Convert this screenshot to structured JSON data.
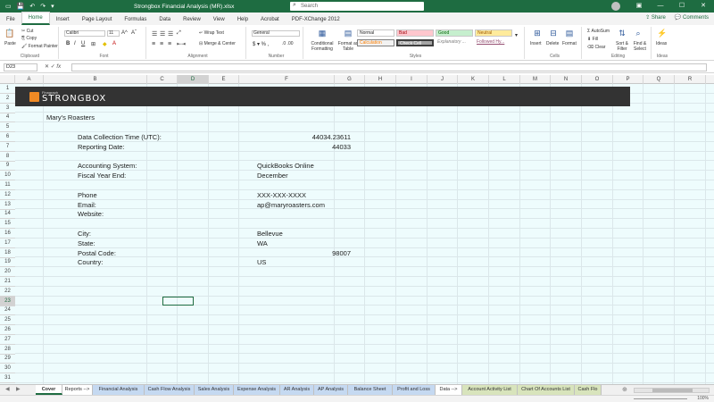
{
  "window": {
    "title": "Strongbox Financial Analysis (MR).xlsx",
    "search_placeholder": "Search",
    "minimize": "—",
    "maximize": "☐",
    "close": "✕"
  },
  "menu": {
    "tabs": [
      "File",
      "Home",
      "Insert",
      "Page Layout",
      "Formulas",
      "Data",
      "Review",
      "View",
      "Help",
      "Acrobat",
      "PDF-XChange 2012"
    ],
    "active": "Home",
    "share": "Share",
    "comments": "Comments"
  },
  "ribbon": {
    "clipboard": {
      "label": "Clipboard",
      "paste": "Paste",
      "cut": "Cut",
      "copy": "Copy",
      "format_painter": "Format Painter"
    },
    "font": {
      "label": "Font",
      "font_name": "Calibri",
      "font_size": "11"
    },
    "alignment": {
      "label": "Alignment",
      "wrap_text": "Wrap Text",
      "merge_center": "Merge & Center"
    },
    "number": {
      "label": "Number",
      "format": "General"
    },
    "styles": {
      "label": "Styles",
      "conditional": "Conditional Formatting",
      "format_table": "Format as Table",
      "normal": "Normal",
      "bad": "Bad",
      "good": "Good",
      "neutral": "Neutral",
      "calculation": "Calculation",
      "check_cell": "Check Cell",
      "explanatory": "Explanatory ...",
      "followed": "Followed Hy..."
    },
    "cells": {
      "label": "Cells",
      "insert": "Insert",
      "delete": "Delete",
      "format": "Format"
    },
    "editing": {
      "label": "Editing",
      "autosum": "AutoSum",
      "fill": "Fill",
      "clear": "Clear",
      "sort_filter": "Sort & Filter",
      "find_select": "Find & Select"
    },
    "ideas": {
      "label": "Ideas",
      "ideas": "Ideas"
    }
  },
  "formula_bar": {
    "name_box": "D23",
    "content": ""
  },
  "columns": [
    "A",
    "B",
    "C",
    "D",
    "E",
    "F",
    "G",
    "H",
    "I",
    "J",
    "K",
    "L",
    "M",
    "N",
    "O",
    "P",
    "Q",
    "R"
  ],
  "selected_column": "D",
  "selected_row": "23",
  "rows": [
    "1",
    "2",
    "3",
    "4",
    "5",
    "6",
    "7",
    "8",
    "9",
    "10",
    "11",
    "12",
    "13",
    "14",
    "15",
    "16",
    "17",
    "18",
    "19",
    "20",
    "21",
    "22",
    "23",
    "24",
    "25",
    "26",
    "27",
    "28",
    "29",
    "30",
    "31"
  ],
  "banner": {
    "small_text": "Finagraph",
    "logo_text": "STRONGBOX"
  },
  "company": "Mary's Roasters",
  "fields": [
    {
      "label": "Data Collection Time (UTC):",
      "value": "44034.23611",
      "numeric": true,
      "row": 6
    },
    {
      "label": "Reporting Date:",
      "value": "44033",
      "numeric": true,
      "row": 7
    },
    {
      "label": "Accounting System:",
      "value": "QuickBooks Online",
      "numeric": false,
      "row": 9
    },
    {
      "label": "Fiscal Year End:",
      "value": "December",
      "numeric": false,
      "row": 10
    },
    {
      "label": "Phone",
      "value": "XXX-XXX-XXXX",
      "numeric": false,
      "row": 12
    },
    {
      "label": "Email:",
      "value": "ap@maryroasters.com",
      "numeric": false,
      "row": 13
    },
    {
      "label": "Website:",
      "value": "",
      "numeric": false,
      "row": 14
    },
    {
      "label": "City:",
      "value": "Bellevue",
      "numeric": false,
      "row": 16
    },
    {
      "label": "State:",
      "value": "WA",
      "numeric": false,
      "row": 17
    },
    {
      "label": "Postal Code:",
      "value": "98007",
      "numeric": true,
      "row": 18
    },
    {
      "label": "Country:",
      "value": "US",
      "numeric": false,
      "row": 19
    }
  ],
  "sheet_tabs": [
    {
      "name": "Cover",
      "color": "#ffffff"
    },
    {
      "name": "Reports -->",
      "color": "#ffffff"
    },
    {
      "name": "Financial Analysis",
      "color": "#c5d9f1"
    },
    {
      "name": "Cash Flow Analysis",
      "color": "#c5d9f1"
    },
    {
      "name": "Sales Analysis",
      "color": "#c5d9f1"
    },
    {
      "name": "Expense Analysis",
      "color": "#c5d9f1"
    },
    {
      "name": "AR Analysis",
      "color": "#c5d9f1"
    },
    {
      "name": "AP Analysis",
      "color": "#c5d9f1"
    },
    {
      "name": "Balance Sheet",
      "color": "#c5d9f1"
    },
    {
      "name": "Profit and Loss",
      "color": "#c5d9f1"
    },
    {
      "name": "Data -->",
      "color": "#ffffff"
    },
    {
      "name": "Account Activity List",
      "color": "#d8e4bc"
    },
    {
      "name": "Chart Of Accounts List",
      "color": "#d8e4bc"
    },
    {
      "name": "Cash Flo",
      "color": "#d8e4bc"
    }
  ],
  "active_sheet": "Cover",
  "status": {
    "zoom": "100%"
  }
}
